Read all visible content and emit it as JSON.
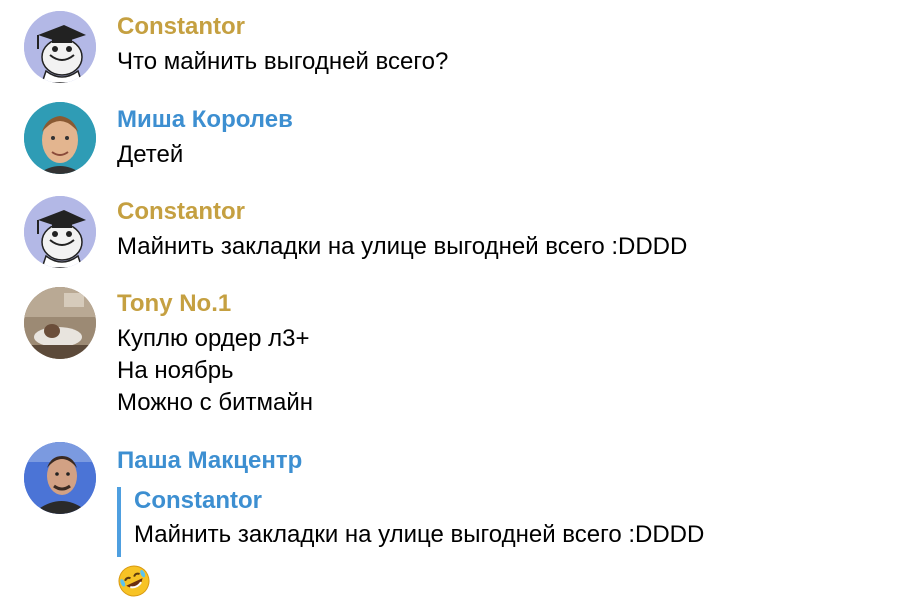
{
  "colors": {
    "name_gold": "#c5a041",
    "name_blue": "#3d8fd1",
    "quote_bar": "#4e9fe0"
  },
  "messages": [
    {
      "author": "Constantor",
      "avatar_icon": "troll-graduate-avatar-icon",
      "lines": [
        "Что майнить выгодней всего?"
      ]
    },
    {
      "author": "Миша Королев",
      "avatar_icon": "person-portrait-avatar-icon",
      "lines": [
        "Детей"
      ]
    },
    {
      "author": "Constantor",
      "avatar_icon": "troll-graduate-avatar-icon",
      "lines": [
        "Майнить закладки на улице выгодней всего :DDDD"
      ]
    },
    {
      "author": "Tony No.1",
      "avatar_icon": "photo-avatar-icon",
      "lines": [
        "Куплю ордер л3+",
        "На ноябрь",
        "Можно с битмайн"
      ]
    },
    {
      "author": "Паша Макцентр",
      "avatar_icon": "selfie-avatar-icon",
      "reply": {
        "author": "Constantor",
        "text": "Майнить закладки на улице выгодней всего :DDDD"
      },
      "emoji_icon": "rofl-emoji-icon"
    }
  ]
}
